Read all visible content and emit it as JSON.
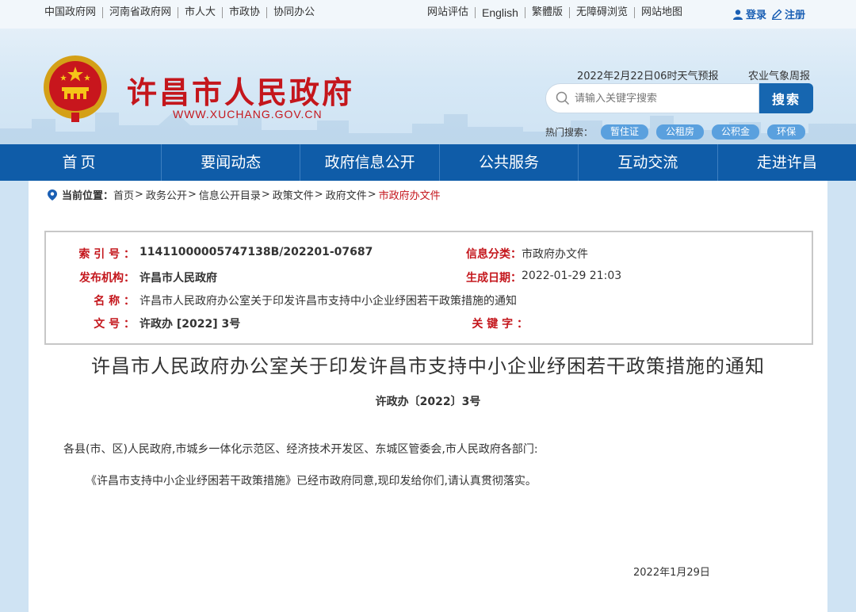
{
  "topbar": {
    "left_links": [
      "中国政府网",
      "河南省政府网",
      "市人大",
      "市政协",
      "协同办公"
    ],
    "right_links": [
      "网站评估",
      "English",
      "繁體版",
      "无障碍浏览",
      "网站地图"
    ],
    "login": "登录",
    "register": "注册"
  },
  "header": {
    "site_title": "许昌市人民政府",
    "site_url": "WWW.XUCHANG.GOV.CN",
    "weather": "2022年2月22日06时天气预报",
    "agri_weather": "农业气象周报",
    "search_placeholder": "请输入关键字搜索",
    "search_button": "搜索",
    "hot_label": "热门搜索：",
    "hot_tags": [
      "暂住证",
      "公租房",
      "公积金",
      "环保"
    ]
  },
  "nav": {
    "items": [
      "首页",
      "要闻动态",
      "政府信息公开",
      "公共服务",
      "互动交流",
      "走进许昌"
    ]
  },
  "breadcrumb": {
    "label": "当前位置：",
    "items": [
      "首页",
      "政务公开",
      "信息公开目录",
      "政策文件",
      "政府文件"
    ],
    "current": "市政府办文件",
    "separator": ">"
  },
  "info": {
    "index_label": "索 引 号 ：",
    "index_value": "11411000005747138B/202201-07687",
    "category_label": "信息分类：",
    "category_value": "市政府办文件",
    "publisher_label": "发布机构：",
    "publisher_value": "许昌市人民政府",
    "date_label": "生成日期：",
    "date_value": "2022-01-29 21:03",
    "name_label": "名  称 ：",
    "name_value": "许昌市人民政府办公室关于印发许昌市支持中小企业纾困若干政策措施的通知",
    "docno_label": "文  号 ：",
    "docno_value": "许政办 [2022] 3号",
    "keywords_label": "关 键 字 ：",
    "keywords_value": ""
  },
  "document": {
    "title": "许昌市人民政府办公室关于印发许昌市支持中小企业纾困若干政策措施的通知",
    "number": "许政办〔2022〕3号",
    "para1": "各县(市、区)人民政府,市城乡一体化示范区、经济技术开发区、东城区管委会,市人民政府各部门:",
    "para2": "《许昌市支持中小企业纾困若干政策措施》已经市政府同意,现印发给你们,请认真贯彻落实。",
    "date": "2022年1月29日"
  },
  "colors": {
    "brand_red": "#c4161c",
    "nav_blue": "#0f5ca8",
    "search_blue": "#1666b0",
    "tag_blue": "#5aa0de"
  }
}
